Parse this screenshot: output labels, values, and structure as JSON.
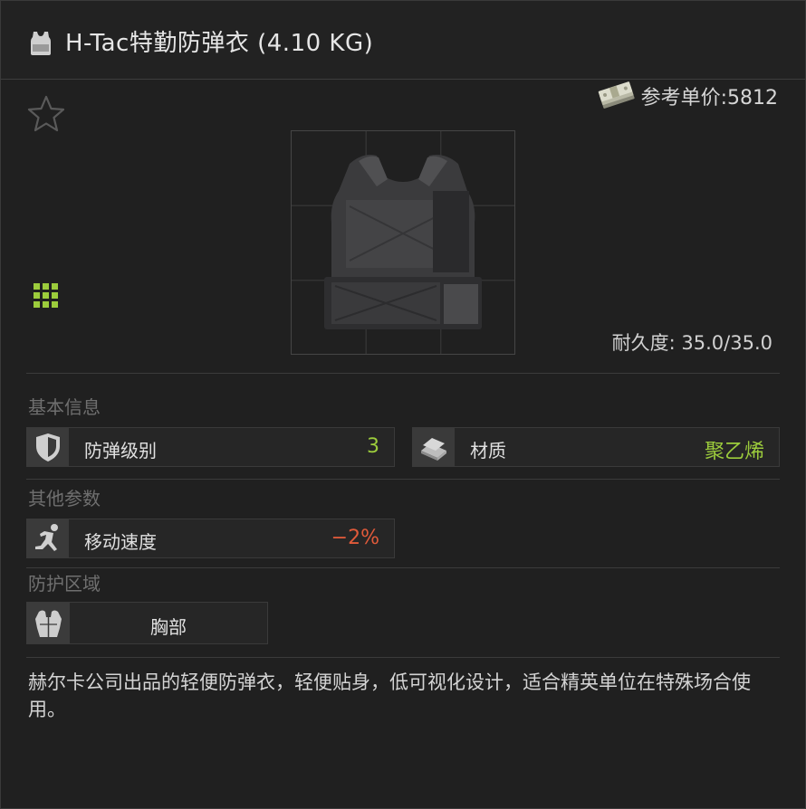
{
  "header": {
    "icon": "vest-icon",
    "title": "H-Tac特勤防弹衣 (4.10 KG)"
  },
  "favorite": {
    "icon": "star-outline-icon"
  },
  "price": {
    "icon": "money-stack-icon",
    "text": "参考单价:5812"
  },
  "inventory_size": {
    "icon": "grid-size-icon",
    "color": "#9ccc3c"
  },
  "item_image": {
    "icon": "body-armor-vest-image"
  },
  "durability": {
    "text": "耐久度: 35.0/35.0"
  },
  "sections": {
    "basic": {
      "title": "基本信息",
      "stats": [
        {
          "icon": "shield-icon",
          "label": "防弹级别",
          "value": "3",
          "value_color": "#9ccc3c"
        },
        {
          "icon": "material-plates-icon",
          "label": "材质",
          "value": "聚乙烯",
          "value_color": "#9ccc3c"
        }
      ]
    },
    "other": {
      "title": "其他参数",
      "stats": [
        {
          "icon": "running-man-icon",
          "label": "移动速度",
          "value": "−2%",
          "value_color": "#e05a3a"
        }
      ]
    },
    "protection": {
      "title": "防护区域",
      "zones": [
        {
          "icon": "chest-armor-icon",
          "label": "胸部"
        }
      ]
    }
  },
  "description": "赫尔卡公司出品的轻便防弹衣，轻便贴身，低可视化设计，适合精英单位在特殊场合使用。"
}
